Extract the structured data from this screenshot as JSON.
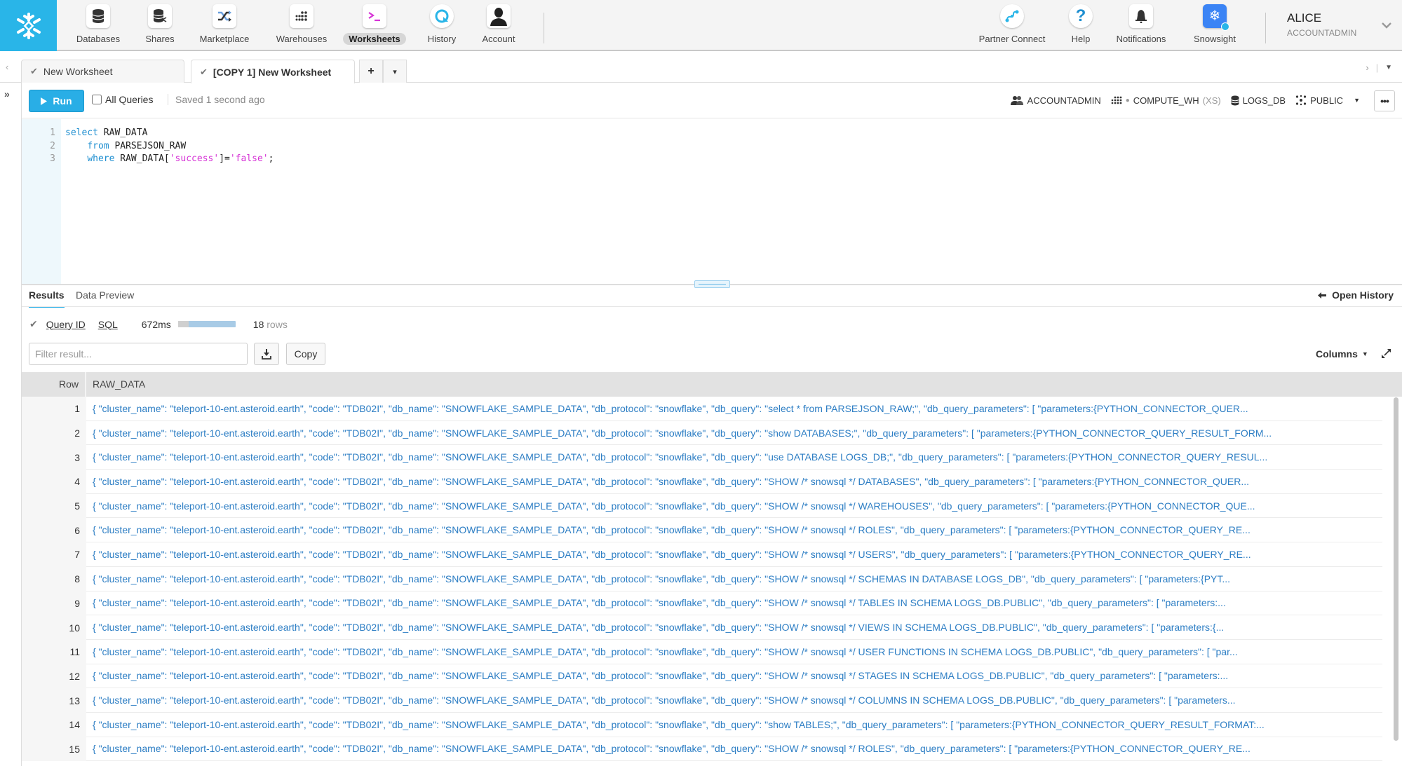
{
  "nav": {
    "logo": "snowflake-logo",
    "items": [
      {
        "label": "Databases",
        "icon": "database-icon"
      },
      {
        "label": "Shares",
        "icon": "share-icon"
      },
      {
        "label": "Marketplace",
        "icon": "shuffle-icon"
      },
      {
        "label": "Warehouses",
        "icon": "warehouse-icon"
      },
      {
        "label": "Worksheets",
        "icon": "terminal-icon",
        "active": true
      },
      {
        "label": "History",
        "icon": "history-icon"
      },
      {
        "label": "Account",
        "icon": "account-icon"
      }
    ],
    "right_items": [
      {
        "label": "Partner Connect",
        "icon": "partner-connect-icon"
      },
      {
        "label": "Help",
        "icon": "help-icon"
      },
      {
        "label": "Notifications",
        "icon": "bell-icon"
      },
      {
        "label": "Snowsight",
        "icon": "snowsight-icon"
      }
    ],
    "user": {
      "name": "ALICE",
      "role": "ACCOUNTADMIN"
    }
  },
  "tabs": {
    "items": [
      {
        "label": "New Worksheet",
        "active": false
      },
      {
        "label": "[COPY 1] New Worksheet",
        "active": true
      }
    ],
    "add_label": "+",
    "menu_label": "▾"
  },
  "toolbar": {
    "run_label": "Run",
    "all_queries_label": "All Queries",
    "all_queries_checked": false,
    "saved_status": "Saved 1 second ago",
    "context": {
      "role": "ACCOUNTADMIN",
      "warehouse": "COMPUTE_WH",
      "warehouse_size": "(XS)",
      "database": "LOGS_DB",
      "schema": "PUBLIC"
    },
    "more_label": "•••"
  },
  "editor": {
    "lines": [
      {
        "num": "1",
        "parts": [
          {
            "t": "select",
            "c": "kw"
          },
          {
            "t": " RAW_DATA",
            "c": ""
          }
        ]
      },
      {
        "num": "2",
        "parts": [
          {
            "t": "    ",
            "c": ""
          },
          {
            "t": "from",
            "c": "kw"
          },
          {
            "t": " PARSEJSON_RAW",
            "c": ""
          }
        ]
      },
      {
        "num": "3",
        "parts": [
          {
            "t": "    ",
            "c": ""
          },
          {
            "t": "where",
            "c": "kw"
          },
          {
            "t": " RAW_DATA[",
            "c": ""
          },
          {
            "t": "'success'",
            "c": "str"
          },
          {
            "t": "]=",
            "c": ""
          },
          {
            "t": "'false'",
            "c": "str"
          },
          {
            "t": ";",
            "c": ""
          }
        ]
      }
    ]
  },
  "results": {
    "tabs": [
      "Results",
      "Data Preview"
    ],
    "open_history_label": "Open History",
    "query_id_label": "Query ID",
    "sql_label": "SQL",
    "duration": "672ms",
    "progress_compile_fraction": 0.18,
    "row_count": "18",
    "rows_label": "rows",
    "filter_placeholder": "Filter result...",
    "copy_label": "Copy",
    "columns_label": "Columns",
    "grid": {
      "headers": [
        "Row",
        "RAW_DATA"
      ],
      "prefix": "{ \"cluster_name\": \"teleport-10-ent.asteroid.earth\", \"code\": \"TDB02I\", \"db_name\": \"SNOWFLAKE_SAMPLE_DATA\", \"db_protocol\": \"snowflake\", \"db_query\": ",
      "rows": [
        {
          "row": "1",
          "raw": "{ \"cluster_name\": \"teleport-10-ent.asteroid.earth\", \"code\": \"TDB02I\", \"db_name\": \"SNOWFLAKE_SAMPLE_DATA\", \"db_protocol\": \"snowflake\", \"db_query\": \"select * from PARSEJSON_RAW;\", \"db_query_parameters\": [ \"parameters:{PYTHON_CONNECTOR_QUER..."
        },
        {
          "row": "2",
          "raw": "{ \"cluster_name\": \"teleport-10-ent.asteroid.earth\", \"code\": \"TDB02I\", \"db_name\": \"SNOWFLAKE_SAMPLE_DATA\", \"db_protocol\": \"snowflake\", \"db_query\": \"show DATABASES;\", \"db_query_parameters\": [ \"parameters:{PYTHON_CONNECTOR_QUERY_RESULT_FORM..."
        },
        {
          "row": "3",
          "raw": "{ \"cluster_name\": \"teleport-10-ent.asteroid.earth\", \"code\": \"TDB02I\", \"db_name\": \"SNOWFLAKE_SAMPLE_DATA\", \"db_protocol\": \"snowflake\", \"db_query\": \"use DATABASE LOGS_DB;\", \"db_query_parameters\": [ \"parameters:{PYTHON_CONNECTOR_QUERY_RESUL..."
        },
        {
          "row": "4",
          "raw": "{ \"cluster_name\": \"teleport-10-ent.asteroid.earth\", \"code\": \"TDB02I\", \"db_name\": \"SNOWFLAKE_SAMPLE_DATA\", \"db_protocol\": \"snowflake\", \"db_query\": \"SHOW /* snowsql */ DATABASES\", \"db_query_parameters\": [ \"parameters:{PYTHON_CONNECTOR_QUER..."
        },
        {
          "row": "5",
          "raw": "{ \"cluster_name\": \"teleport-10-ent.asteroid.earth\", \"code\": \"TDB02I\", \"db_name\": \"SNOWFLAKE_SAMPLE_DATA\", \"db_protocol\": \"snowflake\", \"db_query\": \"SHOW /* snowsql */ WAREHOUSES\", \"db_query_parameters\": [ \"parameters:{PYTHON_CONNECTOR_QUE..."
        },
        {
          "row": "6",
          "raw": "{ \"cluster_name\": \"teleport-10-ent.asteroid.earth\", \"code\": \"TDB02I\", \"db_name\": \"SNOWFLAKE_SAMPLE_DATA\", \"db_protocol\": \"snowflake\", \"db_query\": \"SHOW /* snowsql */ ROLES\", \"db_query_parameters\": [ \"parameters:{PYTHON_CONNECTOR_QUERY_RE..."
        },
        {
          "row": "7",
          "raw": "{ \"cluster_name\": \"teleport-10-ent.asteroid.earth\", \"code\": \"TDB02I\", \"db_name\": \"SNOWFLAKE_SAMPLE_DATA\", \"db_protocol\": \"snowflake\", \"db_query\": \"SHOW /* snowsql */ USERS\", \"db_query_parameters\": [ \"parameters:{PYTHON_CONNECTOR_QUERY_RE..."
        },
        {
          "row": "8",
          "raw": "{ \"cluster_name\": \"teleport-10-ent.asteroid.earth\", \"code\": \"TDB02I\", \"db_name\": \"SNOWFLAKE_SAMPLE_DATA\", \"db_protocol\": \"snowflake\", \"db_query\": \"SHOW /* snowsql */ SCHEMAS IN DATABASE LOGS_DB\", \"db_query_parameters\": [ \"parameters:{PYT..."
        },
        {
          "row": "9",
          "raw": "{ \"cluster_name\": \"teleport-10-ent.asteroid.earth\", \"code\": \"TDB02I\", \"db_name\": \"SNOWFLAKE_SAMPLE_DATA\", \"db_protocol\": \"snowflake\", \"db_query\": \"SHOW /* snowsql */ TABLES IN SCHEMA LOGS_DB.PUBLIC\", \"db_query_parameters\": [ \"parameters:..."
        },
        {
          "row": "10",
          "raw": "{ \"cluster_name\": \"teleport-10-ent.asteroid.earth\", \"code\": \"TDB02I\", \"db_name\": \"SNOWFLAKE_SAMPLE_DATA\", \"db_protocol\": \"snowflake\", \"db_query\": \"SHOW /* snowsql */ VIEWS IN SCHEMA LOGS_DB.PUBLIC\", \"db_query_parameters\": [ \"parameters:{..."
        },
        {
          "row": "11",
          "raw": "{ \"cluster_name\": \"teleport-10-ent.asteroid.earth\", \"code\": \"TDB02I\", \"db_name\": \"SNOWFLAKE_SAMPLE_DATA\", \"db_protocol\": \"snowflake\", \"db_query\": \"SHOW /* snowsql */ USER FUNCTIONS IN SCHEMA LOGS_DB.PUBLIC\", \"db_query_parameters\": [ \"par..."
        },
        {
          "row": "12",
          "raw": "{ \"cluster_name\": \"teleport-10-ent.asteroid.earth\", \"code\": \"TDB02I\", \"db_name\": \"SNOWFLAKE_SAMPLE_DATA\", \"db_protocol\": \"snowflake\", \"db_query\": \"SHOW /* snowsql */ STAGES IN SCHEMA LOGS_DB.PUBLIC\", \"db_query_parameters\": [ \"parameters:..."
        },
        {
          "row": "13",
          "raw": "{ \"cluster_name\": \"teleport-10-ent.asteroid.earth\", \"code\": \"TDB02I\", \"db_name\": \"SNOWFLAKE_SAMPLE_DATA\", \"db_protocol\": \"snowflake\", \"db_query\": \"SHOW /* snowsql */ COLUMNS IN SCHEMA LOGS_DB.PUBLIC\", \"db_query_parameters\": [ \"parameters..."
        },
        {
          "row": "14",
          "raw": "{ \"cluster_name\": \"teleport-10-ent.asteroid.earth\", \"code\": \"TDB02I\", \"db_name\": \"SNOWFLAKE_SAMPLE_DATA\", \"db_protocol\": \"snowflake\", \"db_query\": \"show TABLES;\", \"db_query_parameters\": [ \"parameters:{PYTHON_CONNECTOR_QUERY_RESULT_FORMAT:..."
        },
        {
          "row": "15",
          "raw": "{ \"cluster_name\": \"teleport-10-ent.asteroid.earth\", \"code\": \"TDB02I\", \"db_name\": \"SNOWFLAKE_SAMPLE_DATA\", \"db_protocol\": \"snowflake\", \"db_query\": \"SHOW /* snowsql */ ROLES\", \"db_query_parameters\": [ \"parameters:{PYTHON_CONNECTOR_QUERY_RE..."
        }
      ]
    }
  },
  "colors": {
    "brand": "#29b5e8",
    "run_button": "#29aee6",
    "keyword": "#1d8ed0",
    "string": "#d633d6",
    "result_text": "#2d7ec4"
  }
}
